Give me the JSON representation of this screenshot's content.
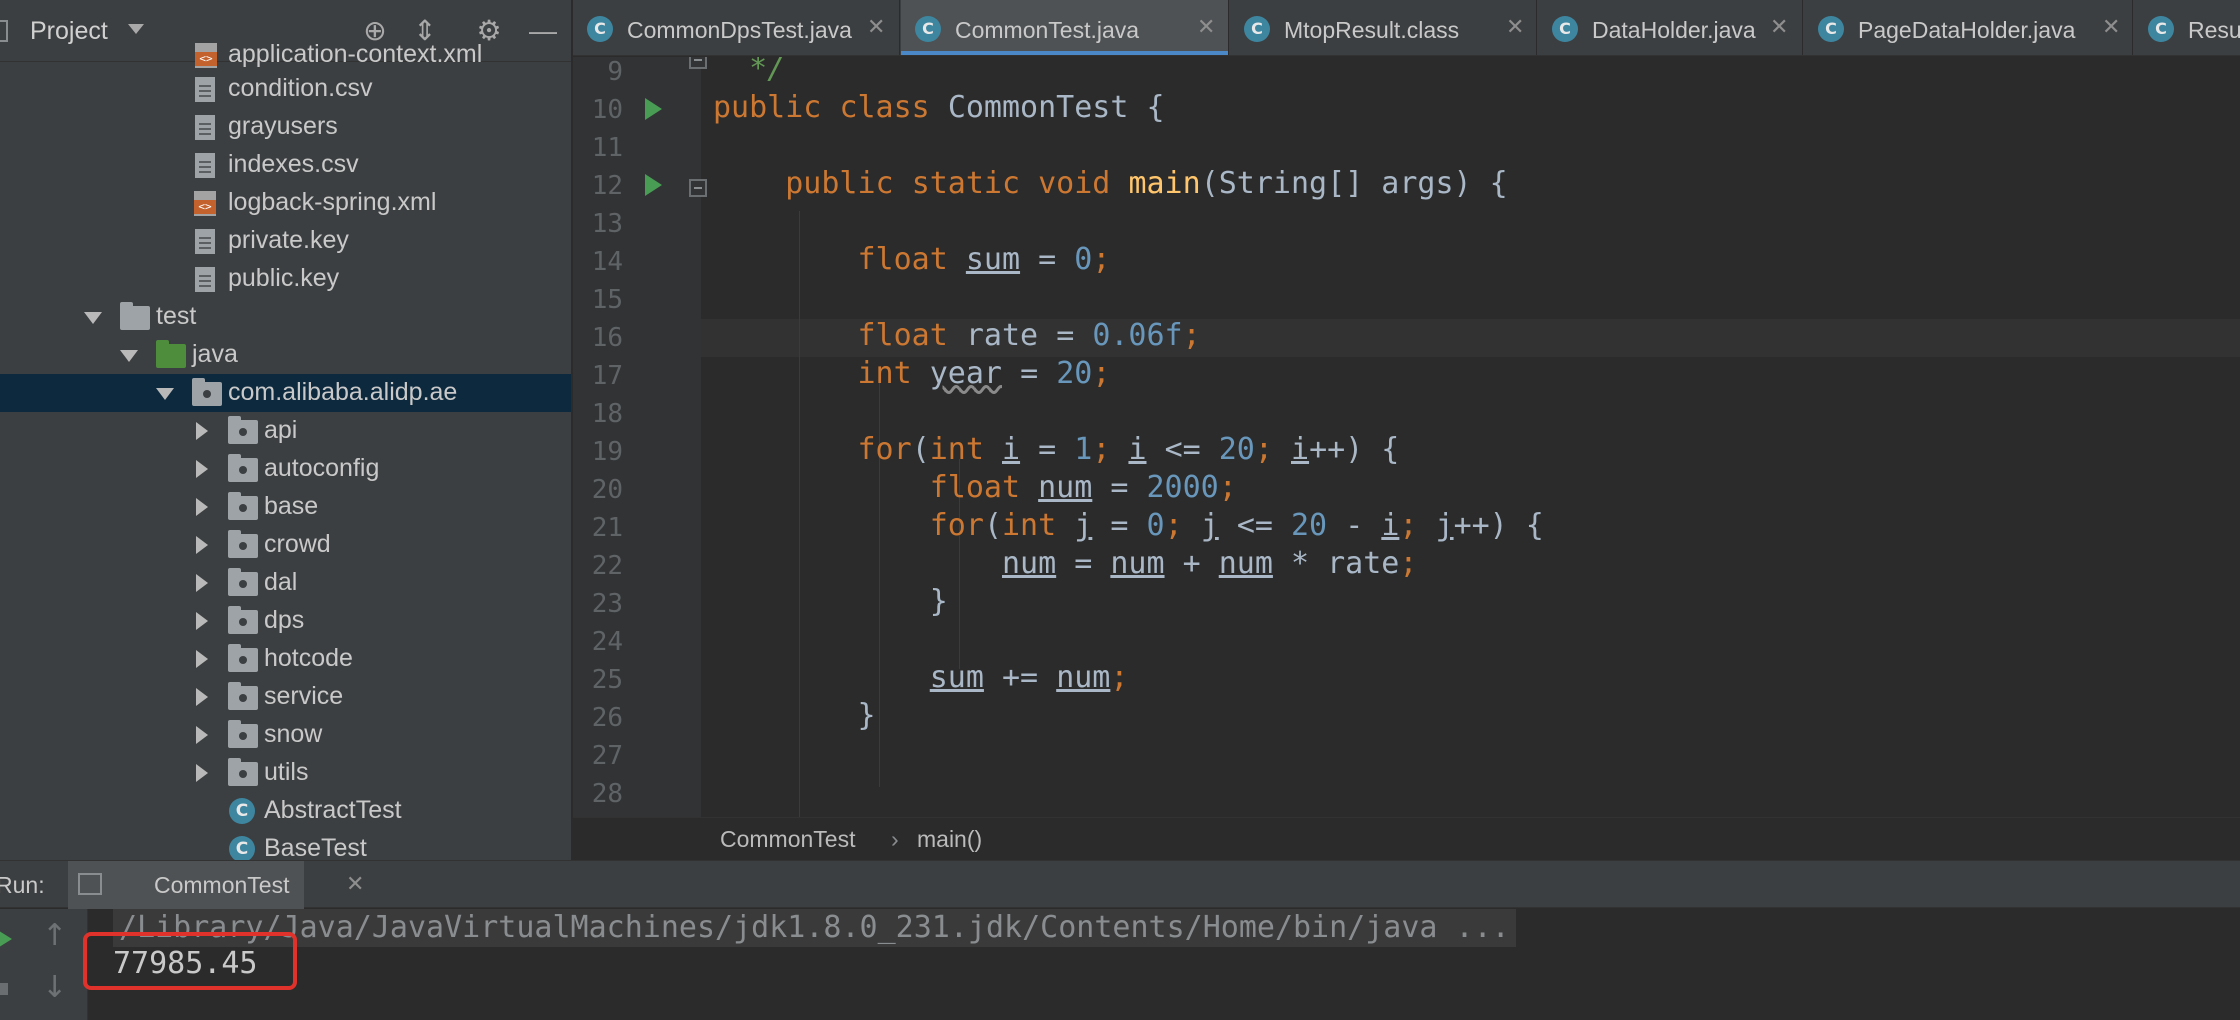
{
  "project_panel": {
    "title": "Project",
    "partial_top_item": "application-context.xml",
    "tree": [
      {
        "label": "condition.csv",
        "icon": "csv-file-icon"
      },
      {
        "label": "grayusers",
        "icon": "text-file-icon"
      },
      {
        "label": "indexes.csv",
        "icon": "csv-file-icon"
      },
      {
        "label": "logback-spring.xml",
        "icon": "xml-file-icon"
      },
      {
        "label": "private.key",
        "icon": "text-file-icon"
      },
      {
        "label": "public.key",
        "icon": "text-file-icon"
      },
      {
        "label": "test",
        "icon": "folder-icon",
        "expanded": true
      },
      {
        "label": "java",
        "icon": "source-folder-icon",
        "expanded": true
      },
      {
        "label": "com.alibaba.alidp.ae",
        "icon": "package-icon",
        "expanded": true,
        "selected": true
      },
      {
        "label": "api",
        "icon": "package-icon",
        "expanded": false
      },
      {
        "label": "autoconfig",
        "icon": "package-icon",
        "expanded": false
      },
      {
        "label": "base",
        "icon": "package-icon",
        "expanded": false
      },
      {
        "label": "crowd",
        "icon": "package-icon",
        "expanded": false
      },
      {
        "label": "dal",
        "icon": "package-icon",
        "expanded": false
      },
      {
        "label": "dps",
        "icon": "package-icon",
        "expanded": false
      },
      {
        "label": "hotcode",
        "icon": "package-icon",
        "expanded": false
      },
      {
        "label": "service",
        "icon": "package-icon",
        "expanded": false
      },
      {
        "label": "snow",
        "icon": "package-icon",
        "expanded": false
      },
      {
        "label": "utils",
        "icon": "package-icon",
        "expanded": false
      },
      {
        "label": "AbstractTest",
        "icon": "abstract-class-icon"
      },
      {
        "label": "BaseTest",
        "icon": "class-icon"
      }
    ]
  },
  "tabs": [
    {
      "label": "CommonDpsTest.java",
      "icon": "C",
      "active": false
    },
    {
      "label": "CommonTest.java",
      "icon": "C",
      "active": true
    },
    {
      "label": "MtopResult.class",
      "icon": "C",
      "active": false
    },
    {
      "label": "DataHolder.java",
      "icon": "C",
      "active": false
    },
    {
      "label": "PageDataHolder.java",
      "icon": "C",
      "active": false
    },
    {
      "label": "Result.class",
      "icon": "C",
      "active": false
    }
  ],
  "editor": {
    "line_numbers": [
      "9",
      "10",
      "11",
      "12",
      "13",
      "14",
      "15",
      "16",
      "17",
      "18",
      "19",
      "20",
      "21",
      "22",
      "23",
      "24",
      "25",
      "26",
      "27",
      "28"
    ],
    "current_line": "16",
    "code": {
      "l9_comment": "*/",
      "l10_kw1": "public",
      "l10_kw2": "class",
      "l10_name": "CommonTest",
      "l10_brace": "{",
      "l12_kw1": "public",
      "l12_kw2": "static",
      "l12_kw3": "void",
      "l12_fn": "main",
      "l12_params": "(String[] args) {",
      "l14_kw": "float",
      "l14_var": "sum",
      "l14_eq": "=",
      "l14_num": "0",
      "l14_semi": ";",
      "l16_kw": "float",
      "l16_var": "rate",
      "l16_eq": "=",
      "l16_num": "0.06f",
      "l16_semi": ";",
      "l17_kw": "int",
      "l17_var": "year",
      "l17_eq": "=",
      "l17_num": "20",
      "l17_semi": ";",
      "l19_kw": "for",
      "l19_p1": "(",
      "l19_kw2": "int",
      "l19_i1": "i",
      "l19_eq": "=",
      "l19_n1": "1",
      "l19_s1": ";",
      "l19_i2": "i",
      "l19_le": "<=",
      "l19_n2": "20",
      "l19_s2": ";",
      "l19_i3": "i",
      "l19_end": "++) {",
      "l20_kw": "float",
      "l20_var": "num",
      "l20_eq": "=",
      "l20_num": "2000",
      "l20_semi": ";",
      "l21_kw": "for",
      "l21_p1": "(",
      "l21_kw2": "int",
      "l21_j1": "j",
      "l21_eq": "=",
      "l21_n1": "0",
      "l21_s1": ";",
      "l21_j2": "j",
      "l21_le": "<=",
      "l21_n2": "20",
      "l21_minus": "-",
      "l21_i": "i",
      "l21_s2": ";",
      "l21_j3": "j",
      "l21_end": "++) {",
      "l22_v1": "num",
      "l22_eq": "=",
      "l22_v2": "num",
      "l22_plus": "+",
      "l22_v3": "num",
      "l22_mul": "*",
      "l22_rate": "rate",
      "l22_semi": ";",
      "l23_brace": "}",
      "l25_var": "sum",
      "l25_op": "+=",
      "l25_v2": "num",
      "l25_semi": ";",
      "l26_brace": "}"
    }
  },
  "breadcrumb": {
    "class_name": "CommonTest",
    "separator": "›",
    "method": "main()"
  },
  "run_panel": {
    "label": "Run:",
    "tab_label": "CommonTest",
    "command": "/Library/Java/JavaVirtualMachines/jdk1.8.0_231.jdk/Contents/Home/bin/java ...",
    "output": "77985.45"
  },
  "colors": {
    "keyword": "#cc7832",
    "number": "#6897bb",
    "method": "#ffc66d",
    "comment": "#629755",
    "selection": "#0d293e",
    "highlight_box": "#e0322b"
  }
}
